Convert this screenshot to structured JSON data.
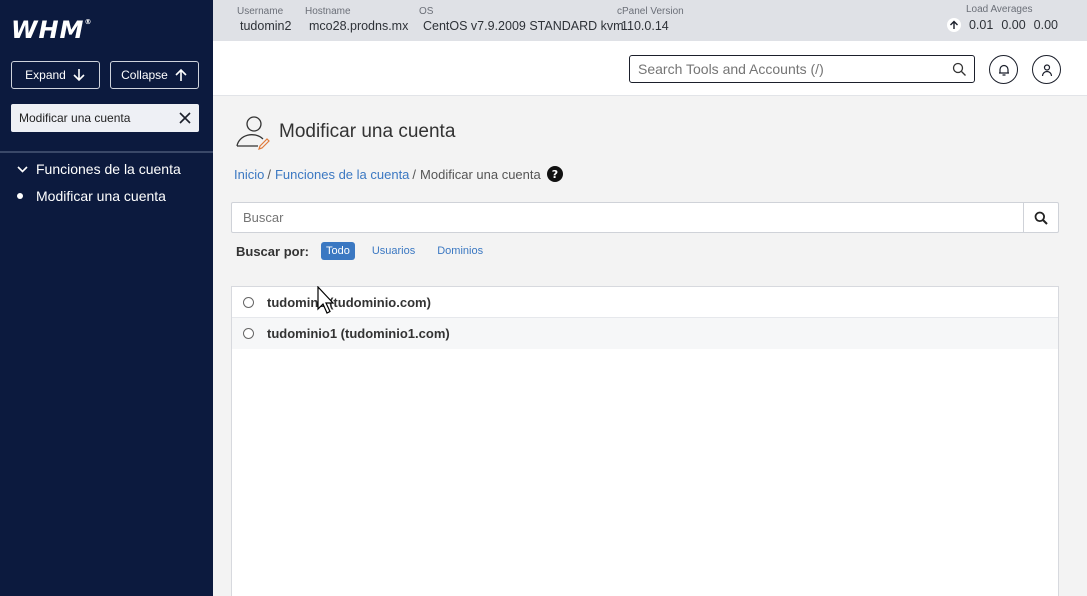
{
  "sidebar": {
    "logo": "WHM",
    "logo_mark": "®",
    "expand_label": "Expand",
    "collapse_label": "Collapse",
    "filter_value": "Modificar una cuenta",
    "category": "Funciones de la cuenta",
    "item": "Modificar una cuenta"
  },
  "infobar": {
    "username_label": "Username",
    "username": "tudomin2",
    "hostname_label": "Hostname",
    "hostname": "mco28.prodns.mx",
    "os_label": "OS",
    "os": "CentOS v7.9.2009 STANDARD kvm",
    "cpanel_label": "cPanel Version",
    "cpanel": "110.0.14",
    "load_label": "Load Averages",
    "load_1": "0.01",
    "load_2": "0.00",
    "load_3": "0.00"
  },
  "header": {
    "search_placeholder": "Search Tools and Accounts (/)"
  },
  "main": {
    "title": "Modificar una cuenta",
    "breadcrumb": {
      "home": "Inicio",
      "category": "Funciones de la cuenta",
      "current": "Modificar una cuenta",
      "sep": "/"
    },
    "search_placeholder": "Buscar",
    "filter_label": "Buscar por:",
    "filters": [
      "Todo",
      "Usuarios",
      "Dominios"
    ],
    "accounts": [
      "tudomin2 (tudominio.com)",
      "tudominio1 (tudominio1.com)"
    ]
  },
  "colors": {
    "sidebar_bg": "#0c1a3e",
    "accent": "#3b78c2",
    "infobar_bg": "#dfe1e6"
  }
}
